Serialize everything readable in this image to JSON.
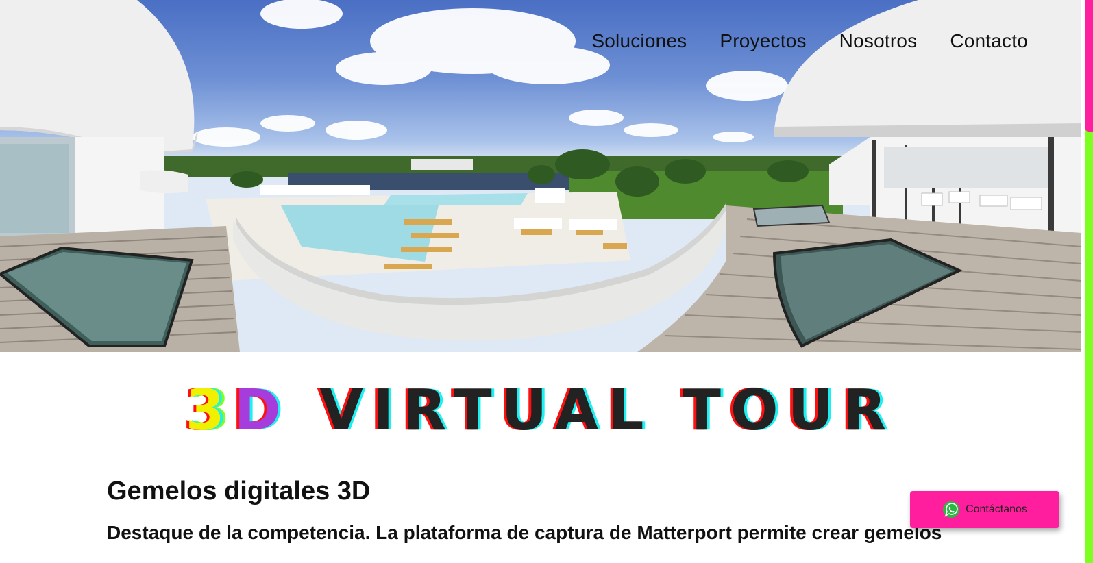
{
  "nav": {
    "items": [
      "Soluciones",
      "Proyectos",
      "Nosotros",
      "Contacto"
    ]
  },
  "hero": {
    "image_description_icon": "panorama-image"
  },
  "title": {
    "prefix_3": "3",
    "prefix_d": "D",
    "main": "VIRTUAL TOUR"
  },
  "section": {
    "heading": "Gemelos digitales 3D",
    "lead": "Destaque de la competencia. La plataforma de captura de Matterport permite crear gemelos"
  },
  "whatsapp": {
    "label": "Contáctanos",
    "icon": "whatsapp-icon",
    "color": "#ff1f9e"
  },
  "colors": {
    "accent_pink": "#ff1f9e",
    "accent_green": "#7dff1f",
    "text": "#111111"
  }
}
